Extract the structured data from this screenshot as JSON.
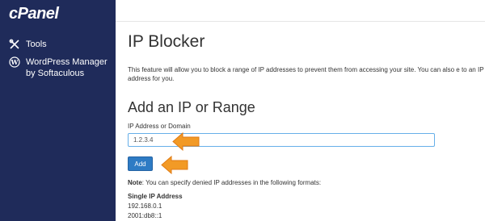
{
  "sidebar": {
    "logo": "cPanel",
    "items": [
      {
        "label": "Tools",
        "icon": "tools-icon"
      },
      {
        "label": "WordPress Manager",
        "label_line2": "by Softaculous",
        "icon": "wordpress-icon"
      }
    ]
  },
  "page": {
    "title": "IP Blocker",
    "description": "This feature will allow you to block a range of IP addresses to prevent them from accessing your site. You can also e to an IP address for you."
  },
  "form": {
    "section_title": "Add an IP or Range",
    "field_label": "IP Address or Domain",
    "field_value": "1.2.3.4",
    "add_label": "Add"
  },
  "note": {
    "label": "Note",
    "text": ": You can specify denied IP addresses in the following formats:"
  },
  "formats": {
    "heading": "Single IP Address",
    "examples": [
      "192.168.0.1",
      "2001:db8::1"
    ]
  },
  "colors": {
    "sidebar": "#1f2b5a",
    "button": "#2e7bc4",
    "arrow": "#f29a26",
    "input_focus": "#66afe9"
  }
}
